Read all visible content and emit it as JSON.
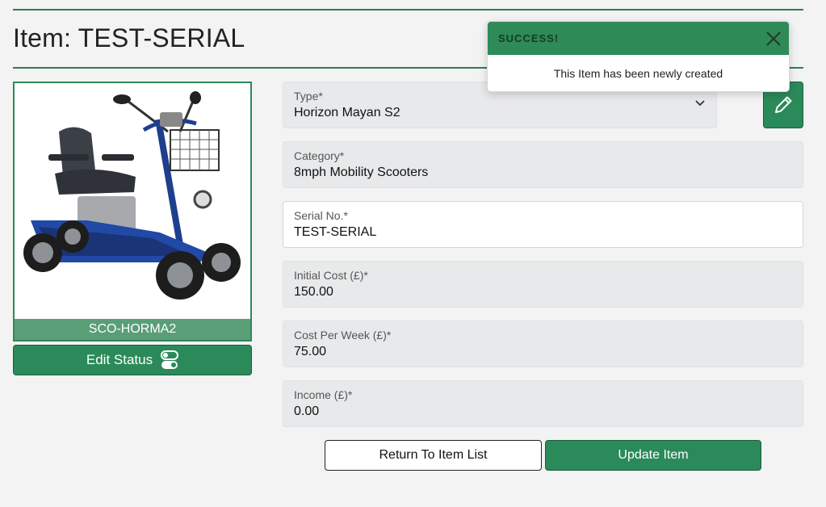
{
  "page": {
    "title": "Item: TEST-SERIAL"
  },
  "item_card": {
    "caption": "SCO-HORMA2",
    "status_button": "Edit Status"
  },
  "form": {
    "type": {
      "label": "Type*",
      "value": "Horizon Mayan S2"
    },
    "category": {
      "label": "Category*",
      "value": "8mph Mobility Scooters"
    },
    "serial": {
      "label": "Serial No.*",
      "value": "TEST-SERIAL"
    },
    "initial_cost": {
      "label": "Initial Cost (£)*",
      "value": "150.00"
    },
    "cost_per_week": {
      "label": "Cost Per Week (£)*",
      "value": "75.00"
    },
    "income": {
      "label": "Income (£)*",
      "value": "0.00"
    }
  },
  "actions": {
    "return_label": "Return To Item List",
    "update_label": "Update Item"
  },
  "toast": {
    "title": "SUCCESS!",
    "message": "This Item has been newly created"
  },
  "icons": {
    "edit": "pencil-icon",
    "toggle": "toggle-icon",
    "dropdown": "chevron-down-icon",
    "close": "close-icon",
    "image": "mobility-scooter-image"
  },
  "colors": {
    "accent": "#2b8a59",
    "accent_dark": "#1c5e3b",
    "caption_bg": "#5a9e78",
    "field_bg": "#e8e9ea"
  }
}
